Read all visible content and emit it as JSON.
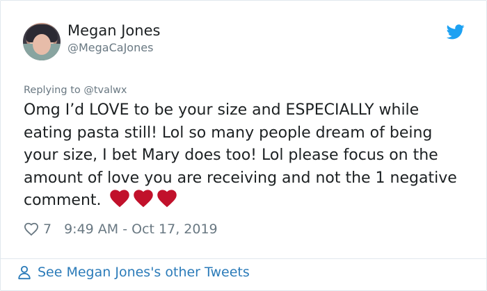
{
  "tweet": {
    "author_name": "Megan Jones",
    "author_handle": "@MegaCaJones",
    "replying_to": "Replying to @tvalwx",
    "text": "Omg I’d LOVE to be your size and ESPECIALLY while eating pasta still! Lol so many people dream of being your size, I bet Mary does too! Lol please focus on the amount of love you are receiving and not the 1 negative comment.",
    "emoji": [
      "red-heart",
      "red-heart",
      "red-heart"
    ],
    "like_count": "7",
    "timestamp": "9:49 AM - Oct 17, 2019"
  },
  "footer": {
    "link_label": "See Megan Jones's other Tweets"
  },
  "colors": {
    "twitter_blue": "#1da1f2",
    "link_blue": "#2b7bb9",
    "muted_text": "#697882",
    "heart_red": "#c1112b"
  }
}
